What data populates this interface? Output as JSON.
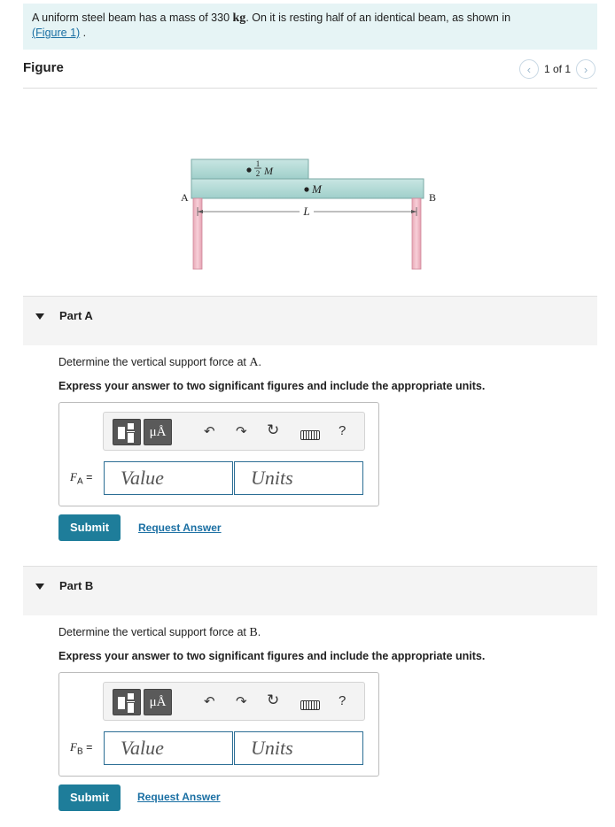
{
  "problem": {
    "text_before": "A uniform steel beam has a mass of 330 ",
    "unit": "kg",
    "text_after": ". On it is resting half of an identical beam, as shown in",
    "link_text": "(Figure 1)",
    "text_end": " ."
  },
  "figure": {
    "title": "Figure",
    "pager_text": "1 of 1",
    "prev_icon": "chevron-left-icon",
    "next_icon": "chevron-right-icon",
    "label_A": "A",
    "label_B": "B",
    "label_half_M": "M",
    "half_num": "1",
    "half_den": "2",
    "label_M": "M",
    "label_L": "L"
  },
  "parts": [
    {
      "header": "Part A",
      "prompt_before": "Determine the vertical support force at ",
      "point": "A",
      "prompt_after": ".",
      "instruction": "Express your answer to two significant figures and include the appropriate units.",
      "var_name": "F",
      "var_sub": "A",
      "equals": "=",
      "value_placeholder": "Value",
      "units_placeholder": "Units",
      "submit_label": "Submit",
      "request_label": "Request Answer"
    },
    {
      "header": "Part B",
      "prompt_before": "Determine the vertical support force at ",
      "point": "B",
      "prompt_after": ".",
      "instruction": "Express your answer to two significant figures and include the appropriate units.",
      "var_name": "F",
      "var_sub": "B",
      "equals": "=",
      "value_placeholder": "Value",
      "units_placeholder": "Units",
      "submit_label": "Submit",
      "request_label": "Request Answer"
    }
  ],
  "toolbar": {
    "mu_label": "μÅ",
    "undo_icon": "undo-icon",
    "redo_icon": "redo-icon",
    "reset_icon": "reset-icon",
    "keyboard_icon": "keyboard-icon",
    "help_label": "?"
  }
}
